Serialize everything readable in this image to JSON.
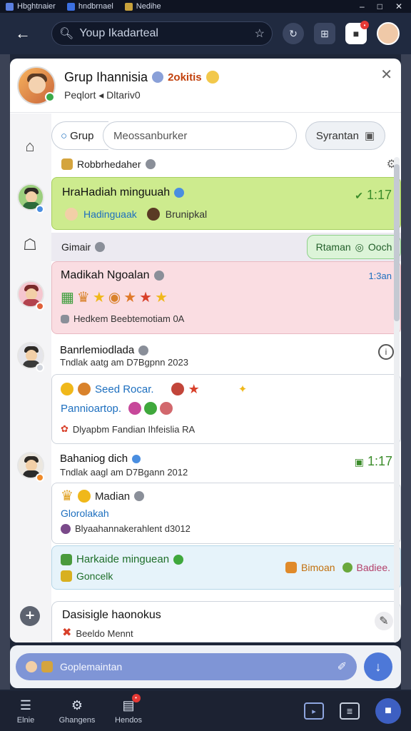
{
  "window": {
    "tabs": [
      "Hbghtnaier",
      "hndbrnael",
      "Nedihe"
    ],
    "controls": [
      "–",
      "□",
      "✕"
    ]
  },
  "header": {
    "search_placeholder": "Youp Ikadarteal"
  },
  "group": {
    "title": "Grup Ihannisia",
    "tag": "2okitis",
    "subtitle": "Peqlort ◂ Dltariv0"
  },
  "tabs": {
    "group_label": "Grup",
    "field_placeholder": "Meossanburker",
    "save_label": "Syrantan"
  },
  "pinned": {
    "label": "Robbrhedaher"
  },
  "highlight_msg": {
    "title": "HraHadiah minguuah",
    "time": "1:17",
    "users": [
      "Hadinguaak",
      "Brunipkal"
    ]
  },
  "section2": {
    "label": "Gimair",
    "button": "Rtaman",
    "button_extra": "Ooch"
  },
  "pink_msg": {
    "title": "Madikah Ngoalan",
    "time": "1:3an",
    "footer": "Hedkem Beebtemotiam 0A"
  },
  "post1": {
    "title": "Banrlemiodlada",
    "meta": "Tndlak aatg am D7Bgpnn 2023",
    "line1": "Seed Rocar.",
    "line2": "Pannioartop.",
    "line3": "Dlyapbm Fandian Ihfeislia RA"
  },
  "post2": {
    "title": "Bahaniog dich",
    "meta": "Tndlak aagl am D7Bgann 2012",
    "time": "1:17",
    "line1": "Madian",
    "line2": "Glorolakah",
    "line3": "Blyaahannakerahlent d3012",
    "green_title": "Harkaide minguean",
    "green_sub": "Goncelk",
    "green_right1": "Bimoan",
    "green_right2": "Badiee."
  },
  "draft": {
    "title": "Dasisigle haonokus",
    "sub": "Beeldo Mennt"
  },
  "composer": {
    "placeholder": "Goplemaintan"
  },
  "bottomnav": {
    "items": [
      "Elnie",
      "Ghangens",
      "Hendos"
    ]
  },
  "colors": {
    "green_bg": "#cdeb8e",
    "pink_bg": "#fadde2",
    "accent": "#4d78d8"
  }
}
